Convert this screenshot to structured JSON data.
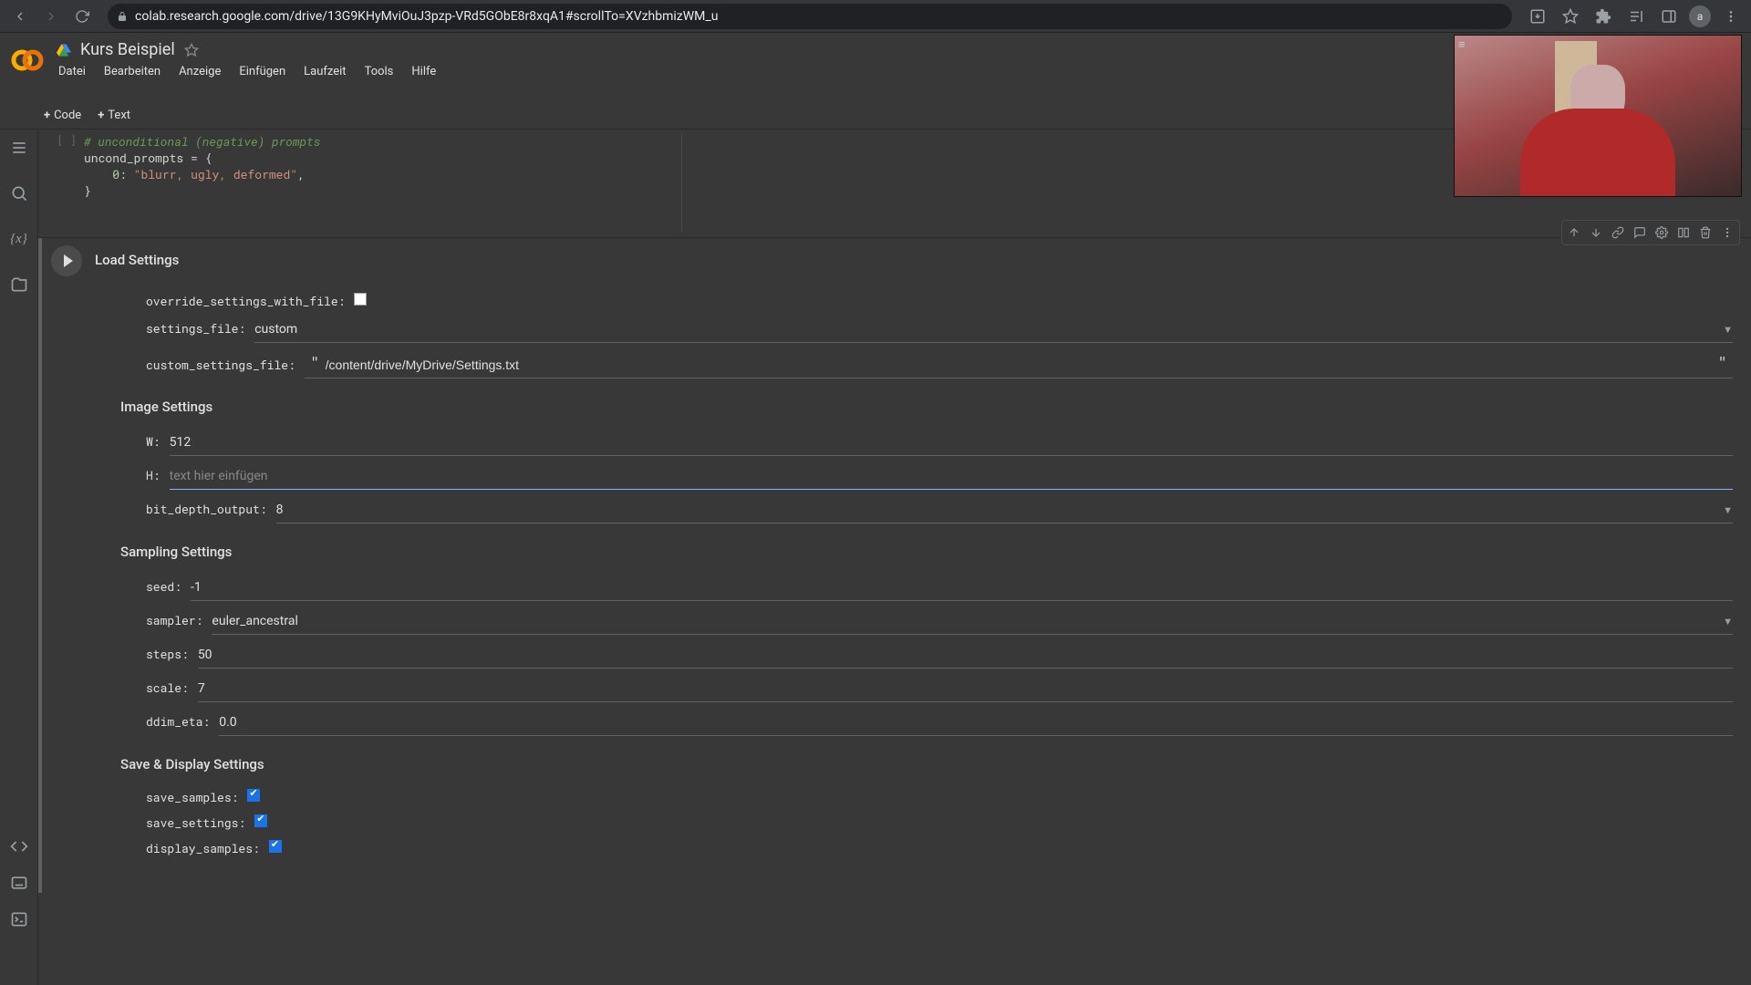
{
  "browser": {
    "url": "colab.research.google.com/drive/13G9KHyMviOuJ3pzp-VRd5GObE8r8xqA1#scrollTo=XVzhbmizWM_u",
    "avatar_initial": "a"
  },
  "header": {
    "doc_title": "Kurs Beispiel",
    "menus": {
      "file": "Datei",
      "edit": "Bearbeiten",
      "view": "Anzeige",
      "insert": "Einfügen",
      "runtime": "Laufzeit",
      "tools": "Tools",
      "help": "Hilfe"
    }
  },
  "toolbar": {
    "code_btn": "Code",
    "text_btn": "Text"
  },
  "code_cell": {
    "comment": "# unconditional (negative) prompts",
    "var_line": "uncond_prompts = {",
    "kv_key": "0",
    "kv_val": "\"blurr, ugly, deformed\"",
    "close": "}"
  },
  "form": {
    "load_title": "Load Settings",
    "image_title": "Image Settings",
    "sampling_title": "Sampling Settings",
    "save_title": "Save & Display Settings",
    "fields": {
      "override_settings_with_file": {
        "label": "override_settings_with_file:",
        "checked": false
      },
      "settings_file": {
        "label": "settings_file:",
        "value": "custom"
      },
      "custom_settings_file": {
        "label": "custom_settings_file:",
        "value": "/content/drive/MyDrive/Settings.txt"
      },
      "W": {
        "label": "W:",
        "value": "512"
      },
      "H": {
        "label": "H:",
        "value": "",
        "placeholder": "text hier einfügen"
      },
      "bit_depth_output": {
        "label": "bit_depth_output:",
        "value": "8"
      },
      "seed": {
        "label": "seed:",
        "value": "-1"
      },
      "sampler": {
        "label": "sampler:",
        "value": "euler_ancestral"
      },
      "steps": {
        "label": "steps:",
        "value": "50"
      },
      "scale": {
        "label": "scale:",
        "value": "7"
      },
      "ddim_eta": {
        "label": "ddim_eta:",
        "value": "0.0"
      },
      "save_samples": {
        "label": "save_samples:",
        "checked": true
      },
      "save_settings": {
        "label": "save_settings:",
        "checked": true
      },
      "display_samples": {
        "label": "display_samples:",
        "checked": true
      }
    }
  }
}
